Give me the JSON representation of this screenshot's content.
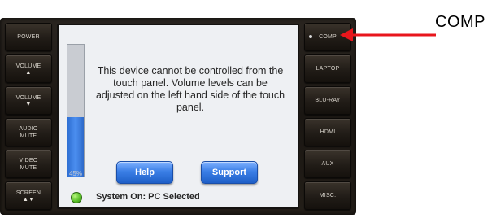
{
  "left_buttons": [
    {
      "label": "POWER",
      "arrow": ""
    },
    {
      "label": "VOLUME",
      "arrow": "▲"
    },
    {
      "label": "VOLUME",
      "arrow": "▼"
    },
    {
      "label": "AUDIO\nMUTE",
      "arrow": ""
    },
    {
      "label": "VIDEO\nMUTE",
      "arrow": ""
    },
    {
      "label": "SCREEN",
      "arrow": "▲▼"
    }
  ],
  "right_buttons": [
    {
      "label": "COMP"
    },
    {
      "label": "LAPTOP"
    },
    {
      "label": "BLU-RAY"
    },
    {
      "label": "HDMI"
    },
    {
      "label": "AUX"
    },
    {
      "label": "MISC."
    }
  ],
  "screen": {
    "message": "This device cannot be controlled from the touch panel.  Volume levels can be adjusted on the left hand side of the touch panel.",
    "volume_percent_text": "45%",
    "volume_level": 0.45,
    "help_label": "Help",
    "support_label": "Support",
    "status_text": "System On:  PC Selected"
  },
  "callout": {
    "label": "COMP",
    "arrow_color": "#e8161c"
  },
  "colors": {
    "status_led": "#5cc12a",
    "volume_fill": "#3b7fe6",
    "button_blue": "#3b7fe6"
  }
}
